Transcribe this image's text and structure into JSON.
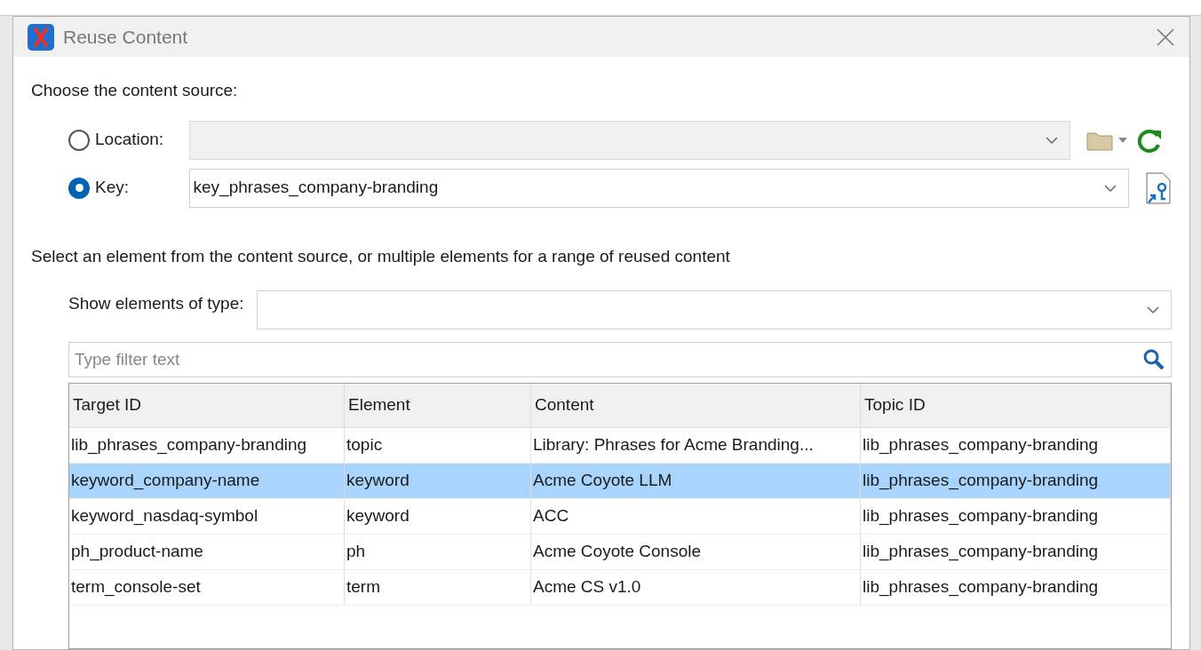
{
  "window": {
    "title": "Reuse Content"
  },
  "source_prompt": "Choose the content source:",
  "sources": [
    {
      "label": "Location:",
      "selected": false,
      "kind": "location"
    },
    {
      "label": "Key:",
      "selected": true,
      "value": "key_phrases_company-branding",
      "kind": "key"
    }
  ],
  "element_prompt": "Select an element from the content source, or multiple elements for a range of reused content",
  "type_filter": {
    "label": "Show elements of type:"
  },
  "filter": {
    "placeholder": "Type filter text"
  },
  "table": {
    "columns": [
      "Target ID",
      "Element",
      "Content",
      "Topic ID"
    ],
    "rows": [
      {
        "cells": [
          "lib_phrases_company-branding",
          "topic",
          "Library: Phrases for Acme Branding...",
          "lib_phrases_company-branding"
        ],
        "selected": false
      },
      {
        "cells": [
          "keyword_company-name",
          "keyword",
          "Acme Coyote LLM",
          "lib_phrases_company-branding"
        ],
        "selected": true
      },
      {
        "cells": [
          "keyword_nasdaq-symbol",
          "keyword",
          "ACC",
          "lib_phrases_company-branding"
        ],
        "selected": false
      },
      {
        "cells": [
          "ph_product-name",
          "ph",
          "Acme Coyote Console",
          "lib_phrases_company-branding"
        ],
        "selected": false
      },
      {
        "cells": [
          "term_console-set",
          "term",
          "Acme CS v1.0",
          "lib_phrases_company-branding"
        ],
        "selected": false
      }
    ]
  }
}
